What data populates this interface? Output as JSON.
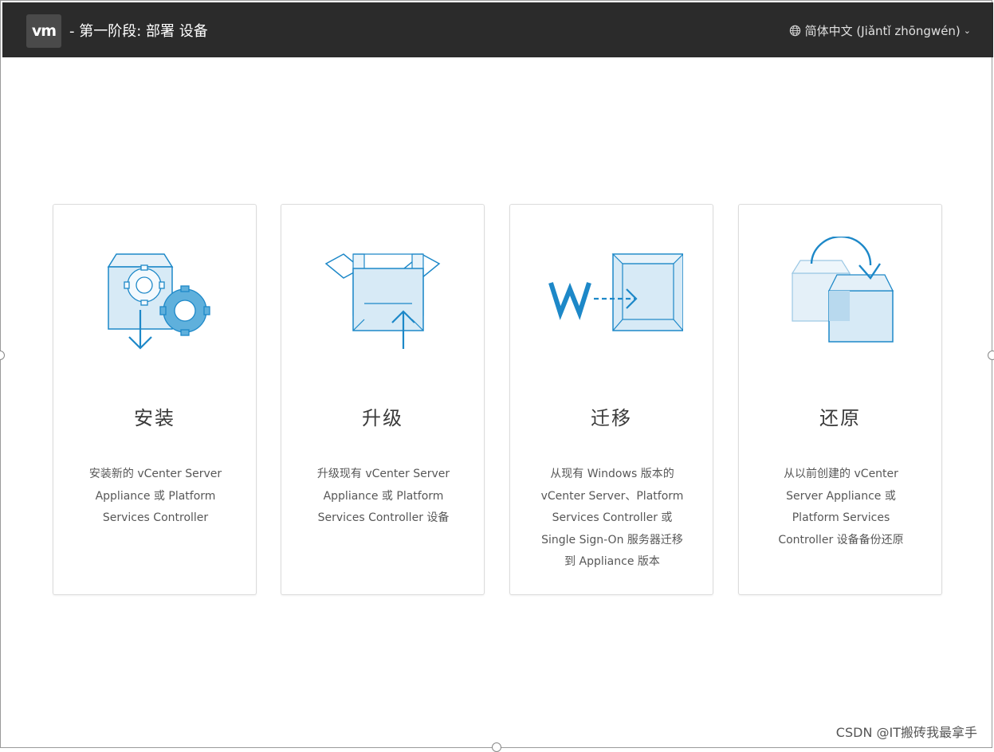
{
  "header": {
    "logo_text": "vm",
    "title": "- 第一阶段: 部署 设备",
    "language": "简体中文 (Jiǎntǐ zhōngwén)",
    "language_icon": "globe-icon",
    "language_chevron": "chevron-down-icon"
  },
  "cards": [
    {
      "icon": "install-icon",
      "title": "安装",
      "desc_lines": [
        "安装新的 vCenter Server",
        "Appliance 或 Platform",
        "Services Controller"
      ]
    },
    {
      "icon": "upgrade-icon",
      "title": "升级",
      "desc_lines": [
        "升级现有 vCenter Server",
        "Appliance 或 Platform",
        "Services Controller 设备"
      ]
    },
    {
      "icon": "migrate-icon",
      "title": "迁移",
      "desc_lines": [
        "从现有 Windows 版本的",
        "vCenter Server、Platform",
        "Services Controller 或",
        "Single Sign-On 服务器迁移",
        "到 Appliance 版本"
      ]
    },
    {
      "icon": "restore-icon",
      "title": "还原",
      "desc_lines": [
        "从以前创建的 vCenter",
        "Server Appliance 或",
        "Platform Services",
        "Controller 设备备份还原"
      ]
    }
  ],
  "watermark": "CSDN @IT搬砖我最拿手",
  "colors": {
    "header_bg": "#2b2b2b",
    "icon_blue": "#1d88c8",
    "icon_fill": "#d7eaf6"
  }
}
